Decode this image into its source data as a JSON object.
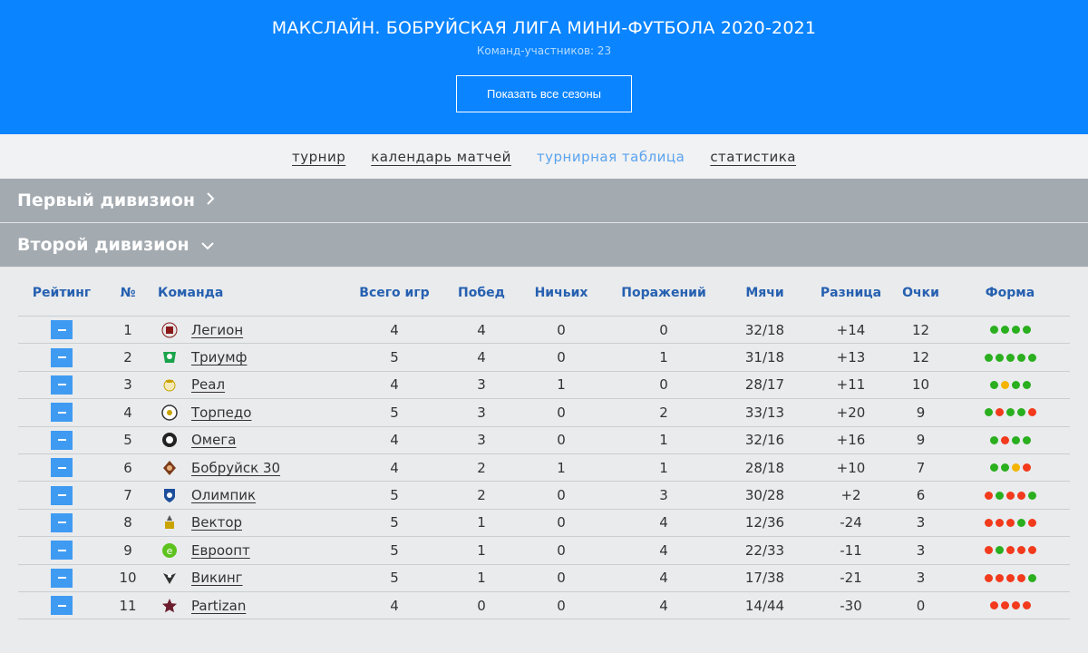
{
  "header": {
    "title": "МАКСЛАЙН. БОБРУЙСКАЯ ЛИГА МИНИ-ФУТБОЛА 2020-2021",
    "subtitle": "Команд-участников: 23",
    "seasons_button": "Показать все сезоны"
  },
  "nav": {
    "tabs": [
      {
        "label": "турнир",
        "active": false
      },
      {
        "label": "календарь матчей",
        "active": false
      },
      {
        "label": "турнирная таблица",
        "active": true
      },
      {
        "label": "статистика",
        "active": false
      }
    ]
  },
  "divisions": [
    {
      "label": "Первый дивизион",
      "icon": "chevron-right-icon"
    },
    {
      "label": "Второй дивизион",
      "icon": "chevron-down-icon"
    }
  ],
  "colors": {
    "win": "#2aaf1e",
    "draw": "#f4b400",
    "loss": "#f23a1c",
    "accent": "#0a84ff"
  },
  "table": {
    "headers": {
      "rank": "Рейтинг",
      "num": "№",
      "team": "Команда",
      "games": "Всего игр",
      "wins": "Побед",
      "draws": "Ничьих",
      "losses": "Поражений",
      "goals": "Мячи",
      "diff": "Разница",
      "points": "Очки",
      "form": "Форма"
    },
    "rows": [
      {
        "num": "1",
        "team": "Легион",
        "logo": "legion-logo",
        "games": "4",
        "wins": "4",
        "draws": "0",
        "losses": "0",
        "goals": "32/18",
        "diff": "+14",
        "points": "12",
        "form": [
          "W",
          "W",
          "W",
          "W"
        ]
      },
      {
        "num": "2",
        "team": "Триумф",
        "logo": "triumph-logo",
        "games": "5",
        "wins": "4",
        "draws": "0",
        "losses": "1",
        "goals": "31/18",
        "diff": "+13",
        "points": "12",
        "form": [
          "W",
          "W",
          "W",
          "W",
          "W"
        ]
      },
      {
        "num": "3",
        "team": "Реал",
        "logo": "real-logo",
        "games": "4",
        "wins": "3",
        "draws": "1",
        "losses": "0",
        "goals": "28/17",
        "diff": "+11",
        "points": "10",
        "form": [
          "W",
          "D",
          "W",
          "W"
        ]
      },
      {
        "num": "4",
        "team": "Торпедо",
        "logo": "torpedo-logo",
        "games": "5",
        "wins": "3",
        "draws": "0",
        "losses": "2",
        "goals": "33/13",
        "diff": "+20",
        "points": "9",
        "form": [
          "W",
          "L",
          "W",
          "W",
          "L"
        ]
      },
      {
        "num": "5",
        "team": "Омега",
        "logo": "omega-logo",
        "games": "4",
        "wins": "3",
        "draws": "0",
        "losses": "1",
        "goals": "32/16",
        "diff": "+16",
        "points": "9",
        "form": [
          "W",
          "L",
          "W",
          "W"
        ]
      },
      {
        "num": "6",
        "team": "Бобруйск 30",
        "logo": "bobruisk-logo",
        "games": "4",
        "wins": "2",
        "draws": "1",
        "losses": "1",
        "goals": "28/18",
        "diff": "+10",
        "points": "7",
        "form": [
          "W",
          "W",
          "D",
          "L"
        ]
      },
      {
        "num": "7",
        "team": "Олимпик",
        "logo": "olimpik-logo",
        "games": "5",
        "wins": "2",
        "draws": "0",
        "losses": "3",
        "goals": "30/28",
        "diff": "+2",
        "points": "6",
        "form": [
          "L",
          "W",
          "L",
          "L",
          "W"
        ]
      },
      {
        "num": "8",
        "team": "Вектор",
        "logo": "vector-logo",
        "games": "5",
        "wins": "1",
        "draws": "0",
        "losses": "4",
        "goals": "12/36",
        "diff": "-24",
        "points": "3",
        "form": [
          "L",
          "L",
          "L",
          "W",
          "L"
        ]
      },
      {
        "num": "9",
        "team": "Евроопт",
        "logo": "evroopt-logo",
        "games": "5",
        "wins": "1",
        "draws": "0",
        "losses": "4",
        "goals": "22/33",
        "diff": "-11",
        "points": "3",
        "form": [
          "L",
          "W",
          "L",
          "L",
          "L"
        ]
      },
      {
        "num": "10",
        "team": "Викинг",
        "logo": "viking-logo",
        "games": "5",
        "wins": "1",
        "draws": "0",
        "losses": "4",
        "goals": "17/38",
        "diff": "-21",
        "points": "3",
        "form": [
          "L",
          "L",
          "L",
          "L",
          "W"
        ]
      },
      {
        "num": "11",
        "team": "Partizan",
        "logo": "partizan-logo",
        "games": "4",
        "wins": "0",
        "draws": "0",
        "losses": "4",
        "goals": "14/44",
        "diff": "-30",
        "points": "0",
        "form": [
          "L",
          "L",
          "L",
          "L"
        ]
      }
    ]
  }
}
